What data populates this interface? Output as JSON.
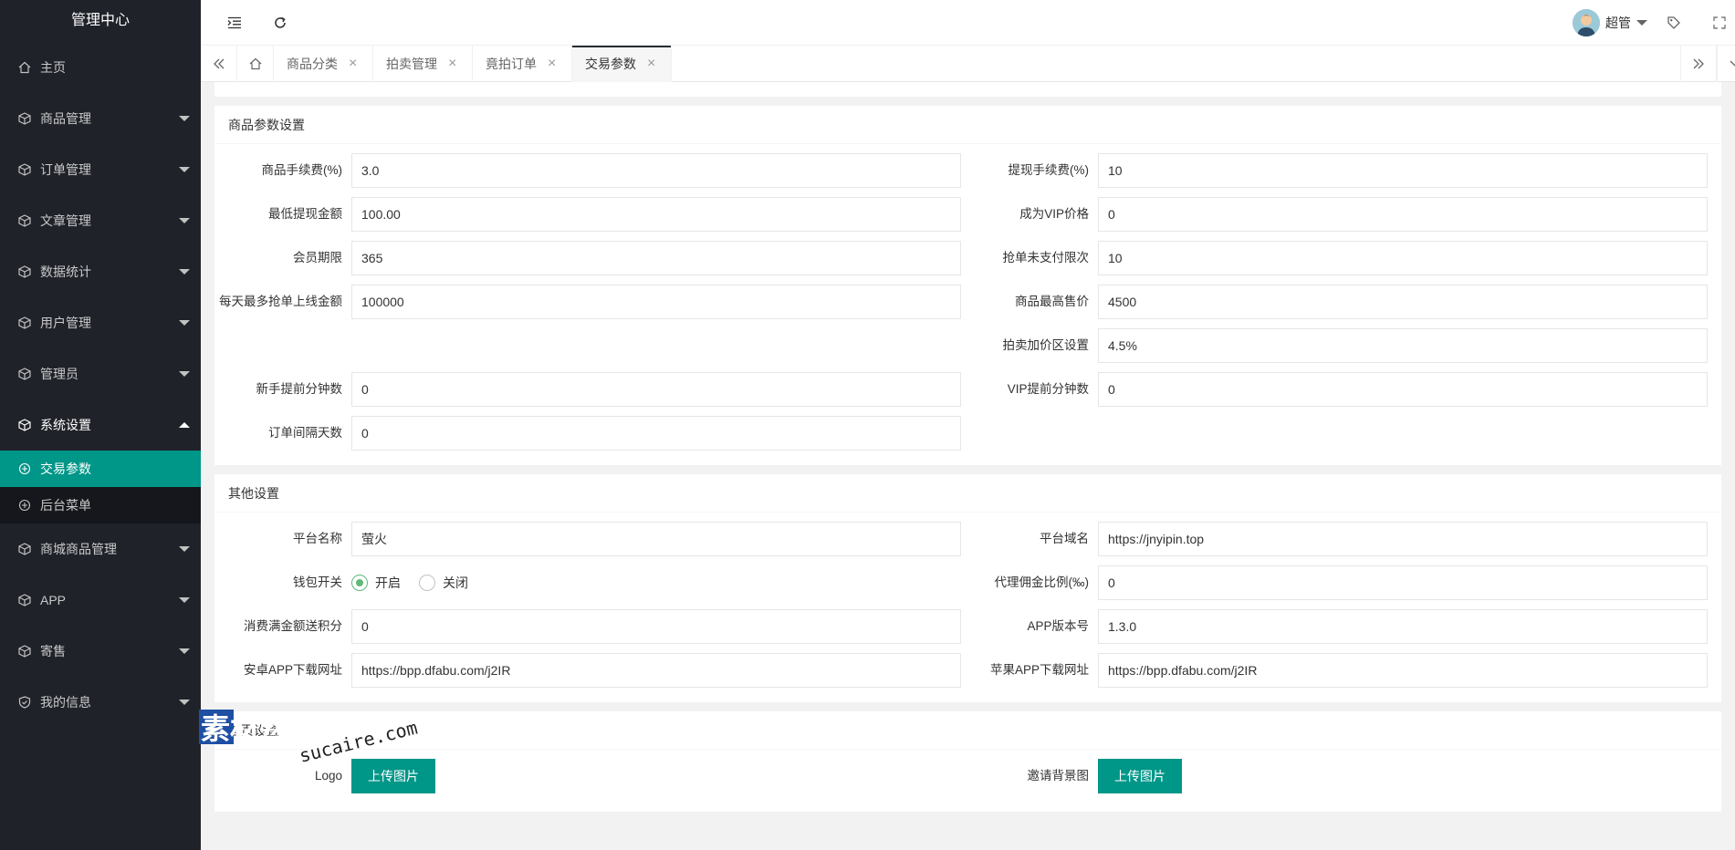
{
  "sidebar": {
    "title": "管理中心",
    "items": [
      {
        "label": "主页"
      },
      {
        "label": "商品管理"
      },
      {
        "label": "订单管理"
      },
      {
        "label": "文章管理"
      },
      {
        "label": "数据统计"
      },
      {
        "label": "用户管理"
      },
      {
        "label": "管理员"
      },
      {
        "label": "系统设置"
      },
      {
        "label": "商城商品管理"
      },
      {
        "label": "APP"
      },
      {
        "label": "寄售"
      },
      {
        "label": "我的信息"
      }
    ],
    "sub_items": [
      {
        "label": "交易参数"
      },
      {
        "label": "后台菜单"
      }
    ]
  },
  "header": {
    "user_name": "超管"
  },
  "tabs": [
    {
      "label": "商品分类"
    },
    {
      "label": "拍卖管理"
    },
    {
      "label": "竟拍订单"
    },
    {
      "label": "交易参数"
    }
  ],
  "goods_section": {
    "title": "商品参数设置",
    "fields": {
      "fee_label": "商品手续费(%)",
      "fee_value": "3.0",
      "withdraw_fee_label": "提现手续费(%)",
      "withdraw_fee_value": "10",
      "min_withdraw_label": "最低提现金额",
      "min_withdraw_value": "100.00",
      "vip_price_label": "成为VIP价格",
      "vip_price_value": "0",
      "member_term_label": "会员期限",
      "member_term_value": "365",
      "unpaid_limit_label": "抢单未支付限次",
      "unpaid_limit_value": "10",
      "daily_max_label": "每天最多抢单上线金额",
      "daily_max_value": "100000",
      "max_price_label": "商品最高售价",
      "max_price_value": "4500",
      "markup_label": "拍卖加价区设置",
      "markup_value": "4.5%",
      "newbie_minutes_label": "新手提前分钟数",
      "newbie_minutes_value": "0",
      "vip_minutes_label": "VIP提前分钟数",
      "vip_minutes_value": "0",
      "order_interval_label": "订单间隔天数",
      "order_interval_value": "0"
    }
  },
  "other_section": {
    "title": "其他设置",
    "fields": {
      "platform_name_label": "平台名称",
      "platform_name_value": "萤火",
      "platform_domain_label": "平台域名",
      "platform_domain_value": "https://jnyipin.top",
      "wallet_label": "钱包开关",
      "wallet_on": "开启",
      "wallet_off": "关闭",
      "agent_ratio_label": "代理佣金比例(‰)",
      "agent_ratio_value": "0",
      "points_label": "消费满金额送积分",
      "points_value": "0",
      "app_version_label": "APP版本号",
      "app_version_value": "1.3.0",
      "android_label": "安卓APP下载网址",
      "android_value": "https://bpp.dfabu.com/j2IR",
      "ios_label": "苹果APP下载网址",
      "ios_value": "https://bpp.dfabu.com/j2IR"
    }
  },
  "home_section": {
    "title": "首页设置",
    "logo_label": "Logo",
    "logo_button": "上传图片",
    "invite_bg_label": "邀请背景图",
    "invite_bg_button": "上传图片"
  },
  "watermark": {
    "text_cn": "素材熟",
    "text_en": "sucaire.com"
  },
  "colors": {
    "sidebar_bg": "#20222a",
    "accent": "#009688",
    "radio_checked": "#5FB878"
  }
}
